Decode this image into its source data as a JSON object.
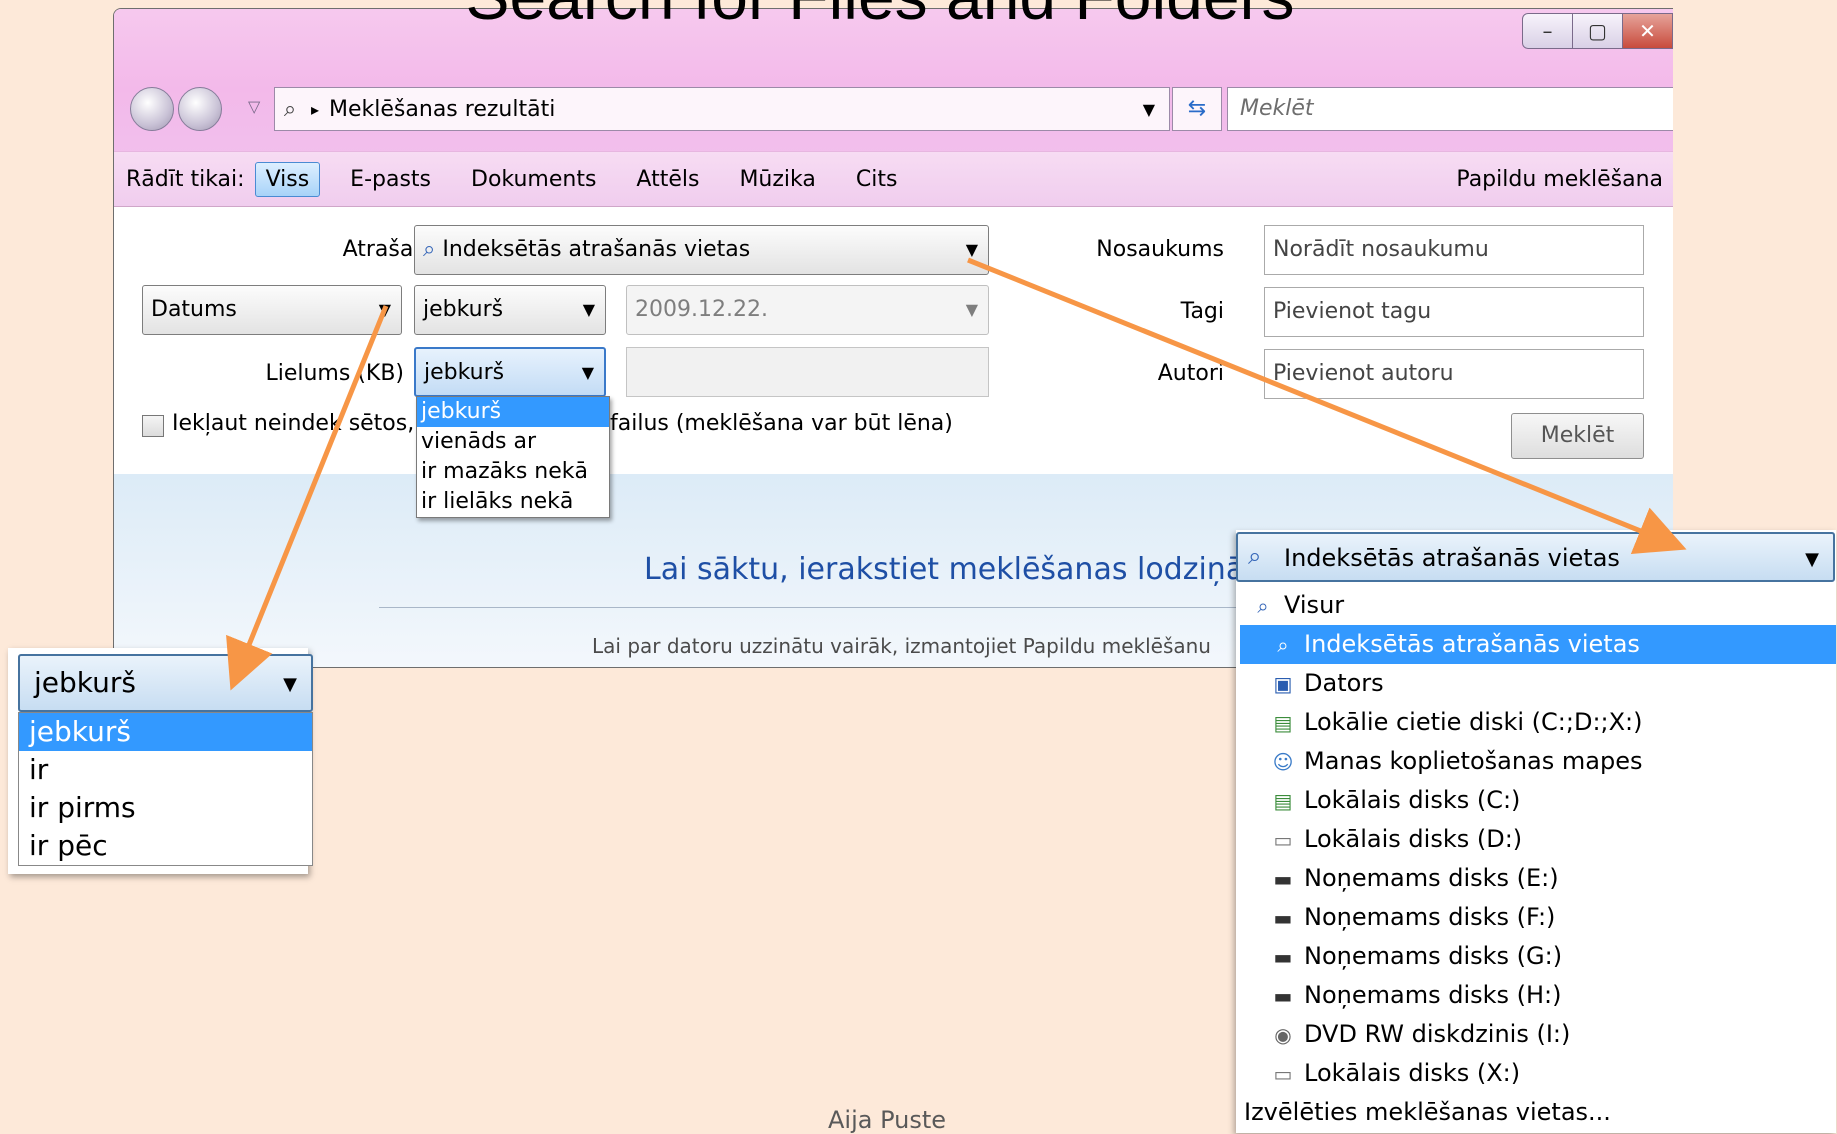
{
  "slide": {
    "title": "Search for Files and Folders",
    "footer": "Aija Puste"
  },
  "window": {
    "caption_buttons": [
      "–",
      "▢",
      "✕"
    ],
    "address": "Meklēšanas rezultāti",
    "search_placeholder": "Meklēt",
    "filter_bar": {
      "label": "Rādīt tikai:",
      "items": [
        "Viss",
        "E-pasts",
        "Dokuments",
        "Attēls",
        "Mūzika",
        "Cits"
      ],
      "active": "Viss",
      "advanced": "Papildu meklēšana"
    }
  },
  "form": {
    "location_label": "Atrašanās vieta",
    "location_value": "Indeksētās atrašanās vietas",
    "date_field": "Datums",
    "date_condition": "jebkurš",
    "date_value": "2009.12.22.",
    "size_label": "Lielums (KB)",
    "size_condition": "jebkurš",
    "size_value": "",
    "include_label": "Iekļaut neindeksētos, slēptos un sistēmas failus (meklēšana var būt lēna)",
    "include_label_visible_left": "Iekļaut neindek sētos, sl",
    "include_label_visible_right": "failus (meklēšana var būt lēna)",
    "name_label": "Nosaukums",
    "name_placeholder": "Norādīt nosaukumu",
    "tags_label": "Tagi",
    "tags_placeholder": "Pievienot tagu",
    "author_label": "Autori",
    "author_placeholder": "Pievienot autoru",
    "search_button": "Meklēt"
  },
  "size_dropdown": {
    "options": [
      "jebkurš",
      "vienāds ar",
      "ir mazāks nekā",
      "ir lielāks nekā"
    ],
    "selected": "jebkurš"
  },
  "lower_panel": {
    "hint": "Lai sāktu, ierakstiet meklēšanas lodziņā",
    "subhint": "Lai par datoru uzzinātu vairāk, izmantojiet Papildu meklēšanu"
  },
  "date_dropdown": {
    "value": "jebkurš",
    "options": [
      "jebkurš",
      "ir",
      "ir pirms",
      "ir pēc"
    ],
    "selected": "jebkurš"
  },
  "location_dropdown": {
    "value": "Indeksētās atrašanās vietas",
    "options": [
      {
        "label": "Visur",
        "icon": "search-icon"
      },
      {
        "label": "Indeksētās atrašanās vietas",
        "icon": "search-icon"
      },
      {
        "label": "Dators",
        "icon": "computer-icon"
      },
      {
        "label": "Lokālie cietie diski (C:;D:;X:)",
        "icon": "drive-icon"
      },
      {
        "label": "Manas koplietošanas mapes",
        "icon": "shared-folder-icon"
      },
      {
        "label": "Lokālais disks (C:)",
        "icon": "drive-icon"
      },
      {
        "label": "Lokālais disks (D:)",
        "icon": "hdd-icon"
      },
      {
        "label": "Noņemams disks (E:)",
        "icon": "removable-disk-icon"
      },
      {
        "label": "Noņemams disks (F:)",
        "icon": "removable-disk-icon"
      },
      {
        "label": "Noņemams disks (G:)",
        "icon": "removable-disk-icon"
      },
      {
        "label": "Noņemams disks (H:)",
        "icon": "removable-disk-icon"
      },
      {
        "label": "DVD RW diskdzinis (I:)",
        "icon": "dvd-icon"
      },
      {
        "label": "Lokālais disks (X:)",
        "icon": "hdd-icon"
      },
      {
        "label": "Izvēlēties meklēšanas vietas...",
        "icon": ""
      }
    ],
    "selected": "Indeksētās atrašanās vietas"
  },
  "colors": {
    "slide_background": "#fde9d9",
    "window_chrome": "#f3b9ea",
    "selection": "#3399ff",
    "arrow": "#f79646",
    "hint_text": "#1e4fa5"
  }
}
